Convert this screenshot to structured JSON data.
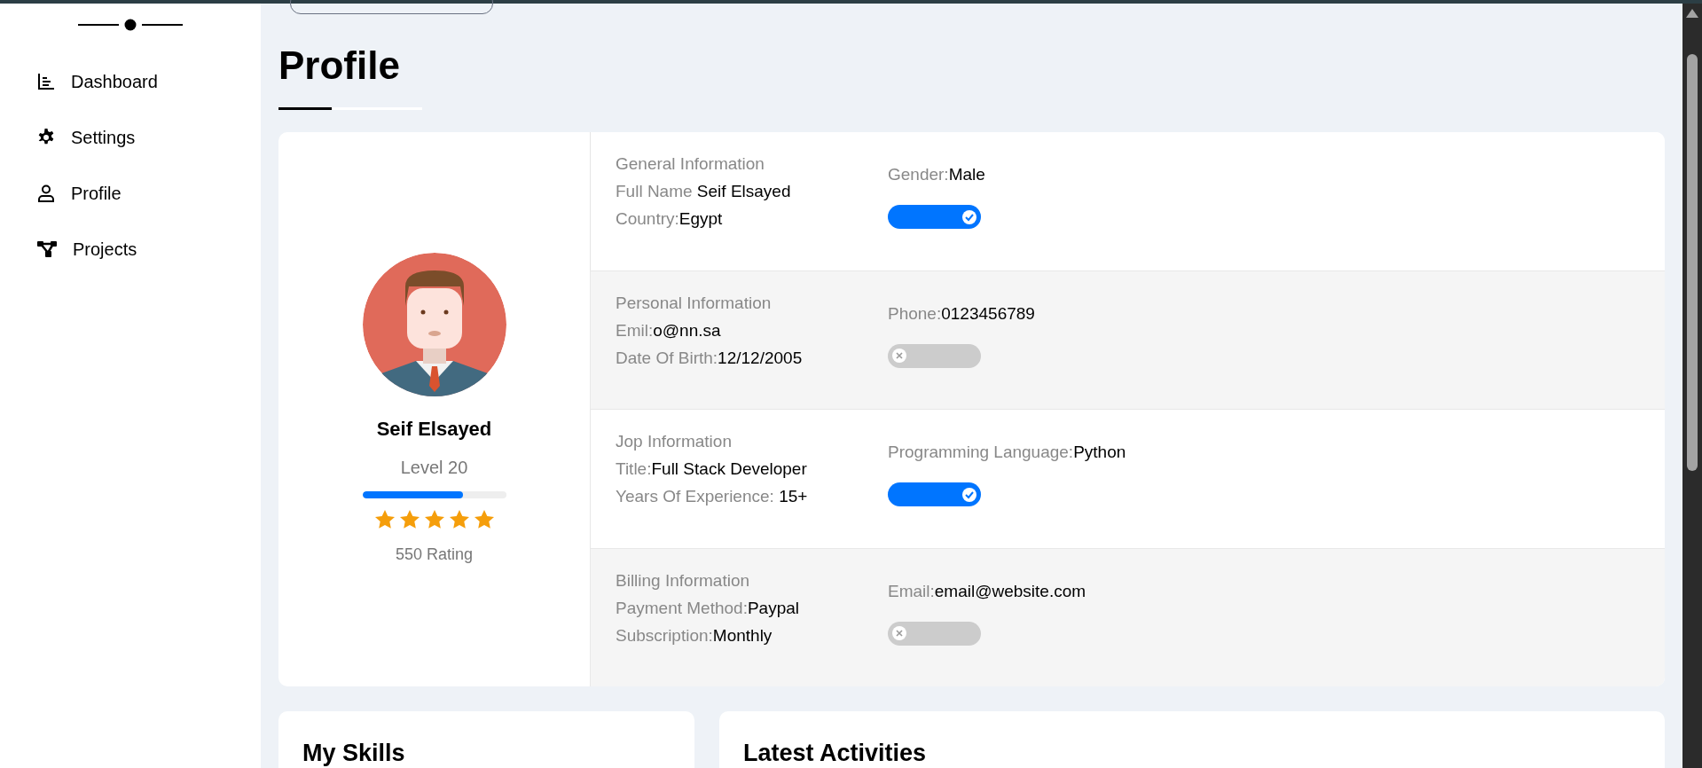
{
  "sidebar": {
    "items": [
      {
        "kind": "chart",
        "label": "Dashboard",
        "selected": false
      },
      {
        "kind": "gear",
        "label": "Settings",
        "selected": false
      },
      {
        "kind": "user",
        "label": "Profile",
        "selected": false
      },
      {
        "kind": "nodes",
        "label": "Projects",
        "selected": false
      }
    ]
  },
  "page_title": "Profile",
  "profile": {
    "name": "Seif Elsayed",
    "level_text": "Level 20",
    "level": 0.7,
    "stars": 5,
    "rating": "550 Rating"
  },
  "sections": [
    {
      "title": "General Information",
      "fields": [
        {
          "label": "Full Name ",
          "value": "Seif Elsayed"
        },
        {
          "label": "Country:",
          "value": "Egypt"
        }
      ],
      "side": {
        "label": "Gender:",
        "value": "Male"
      },
      "on": true
    },
    {
      "title": "Personal Information",
      "fields": [
        {
          "label": "Emil:",
          "value": "o@nn.sa"
        },
        {
          "label": "Date Of Birth:",
          "value": "12/12/2005"
        }
      ],
      "side": {
        "label": "Phone:",
        "value": "0123456789"
      },
      "on": false
    },
    {
      "title": "Jop Information",
      "fields": [
        {
          "label": "Title:",
          "value": "Full Stack Developer"
        },
        {
          "label": "Years Of Experience: ",
          "value": "15+"
        }
      ],
      "side": {
        "label": "Programming Language:",
        "value": "Python"
      },
      "on": true
    },
    {
      "title": "Billing Information",
      "fields": [
        {
          "label": "Payment Method:",
          "value": "Paypal"
        },
        {
          "label": "Subscription:",
          "value": "Monthly"
        }
      ],
      "side": {
        "label": "Email:",
        "value": "email@website.com"
      },
      "on": false
    }
  ],
  "bottom_cards": [
    {
      "title": "My Skills"
    },
    {
      "title": "Latest Activities"
    }
  ]
}
